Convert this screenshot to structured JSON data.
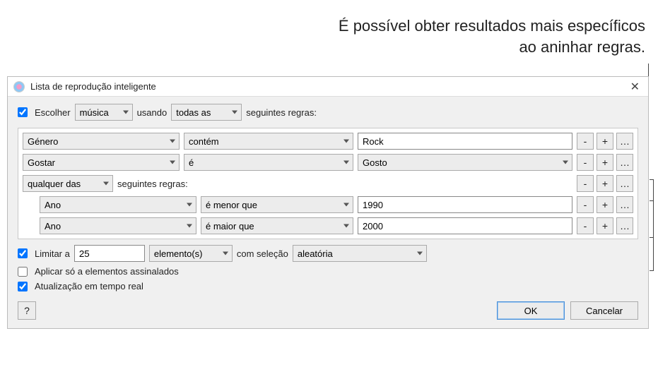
{
  "callout": "É possível obter resultados mais específicos ao aninhar regras.",
  "dialog_title": "Lista de reprodução inteligente",
  "top": {
    "choose_label": "Escolher",
    "media_type": "música",
    "using_label": "usando",
    "match": "todas as",
    "following_rules_label": "seguintes regras:"
  },
  "rules": [
    {
      "indent": 0,
      "field": "Género",
      "op": "contém",
      "value_type": "text",
      "value": "Rock"
    },
    {
      "indent": 0,
      "field": "Gostar",
      "op": "é",
      "value_type": "select",
      "value": "Gosto"
    },
    {
      "indent": 0,
      "field": "group",
      "any": "qualquer das",
      "following_rules_label": "seguintes regras:"
    },
    {
      "indent": 1,
      "field": "Ano",
      "op": "é menor que",
      "value_type": "text",
      "value": "1990"
    },
    {
      "indent": 1,
      "field": "Ano",
      "op": "é maior que",
      "value_type": "text",
      "value": "2000"
    }
  ],
  "row_buttons": {
    "minus": "-",
    "plus": "+",
    "more": "…"
  },
  "limit": {
    "label": "Limitar a",
    "value": "25",
    "unit": "elemento(s)",
    "selection_label": "com seleção",
    "selection": "aleatória"
  },
  "checked_only_label": "Aplicar só a elementos assinalados",
  "live_update_label": "Atualização em tempo real",
  "checks": {
    "choose": true,
    "limit": true,
    "checked_only": false,
    "live": true
  },
  "footer": {
    "help": "?",
    "ok": "OK",
    "cancel": "Cancelar"
  }
}
